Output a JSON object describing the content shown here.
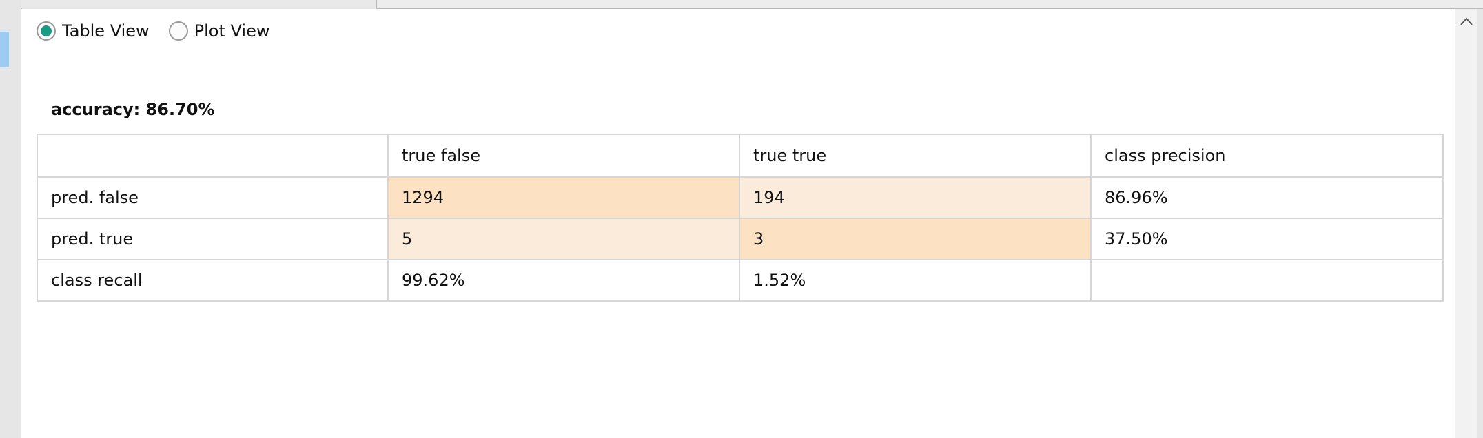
{
  "view_toggle": {
    "options": [
      {
        "label": "Table View",
        "selected": true
      },
      {
        "label": "Plot View",
        "selected": false
      }
    ]
  },
  "accuracy_label": "accuracy: 86.70%",
  "matrix": {
    "headers": [
      "",
      "true false",
      "true true",
      "class precision"
    ],
    "rows": [
      {
        "label": "pred. false",
        "cells": [
          "1294",
          "194",
          "86.96%"
        ]
      },
      {
        "label": "pred. true",
        "cells": [
          "5",
          "3",
          "37.50%"
        ]
      },
      {
        "label": "class recall",
        "cells": [
          "99.62%",
          "1.52%",
          ""
        ]
      }
    ]
  },
  "colors": {
    "radio_selected": "#1a9a85",
    "cell_strong": "#fce1c3",
    "cell_light": "#faebdb",
    "sidebar_highlight": "#9ecbf2"
  },
  "icons": {
    "scroll_up": "chevron-up-icon"
  }
}
